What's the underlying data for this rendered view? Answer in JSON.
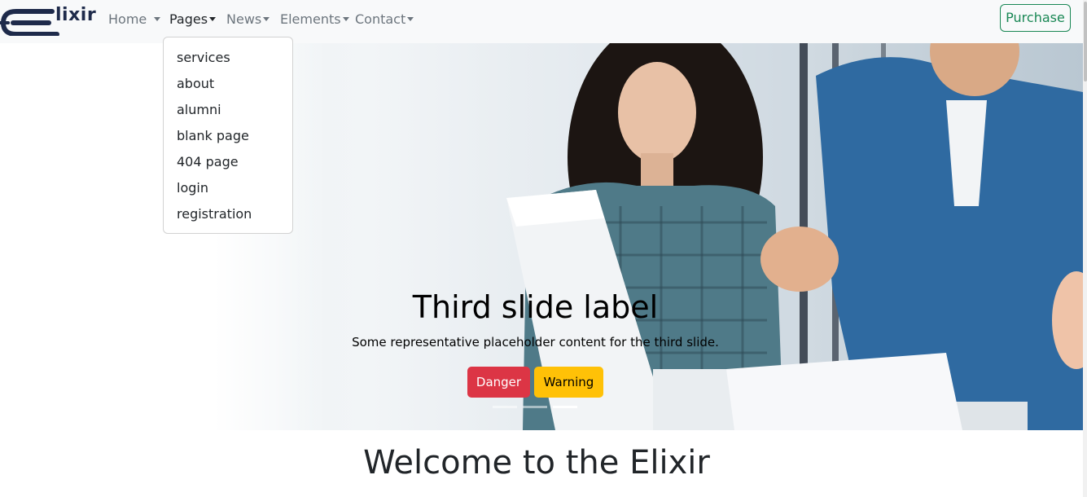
{
  "brand": {
    "name": "lixir"
  },
  "nav": {
    "items": [
      {
        "label": "Home"
      },
      {
        "label": "Pages"
      },
      {
        "label": "News"
      },
      {
        "label": "Elements"
      },
      {
        "label": "Contact"
      }
    ],
    "purchase_label": "Purchase"
  },
  "pages_dropdown": {
    "items": [
      "services",
      "about",
      "alumni",
      "blank page",
      "404 page",
      "login",
      "registration"
    ]
  },
  "carousel": {
    "title": "Third slide label",
    "text": "Some representative placeholder content for the third slide.",
    "danger_label": "Danger",
    "warning_label": "Warning",
    "indicators_count": 3,
    "active_index": 2
  },
  "welcome": {
    "title": "Welcome to the Elixir"
  },
  "colors": {
    "brand_dark": "#1e2a4a",
    "purchase_green": "#198754",
    "danger": "#dc3545",
    "warning": "#ffc107"
  }
}
